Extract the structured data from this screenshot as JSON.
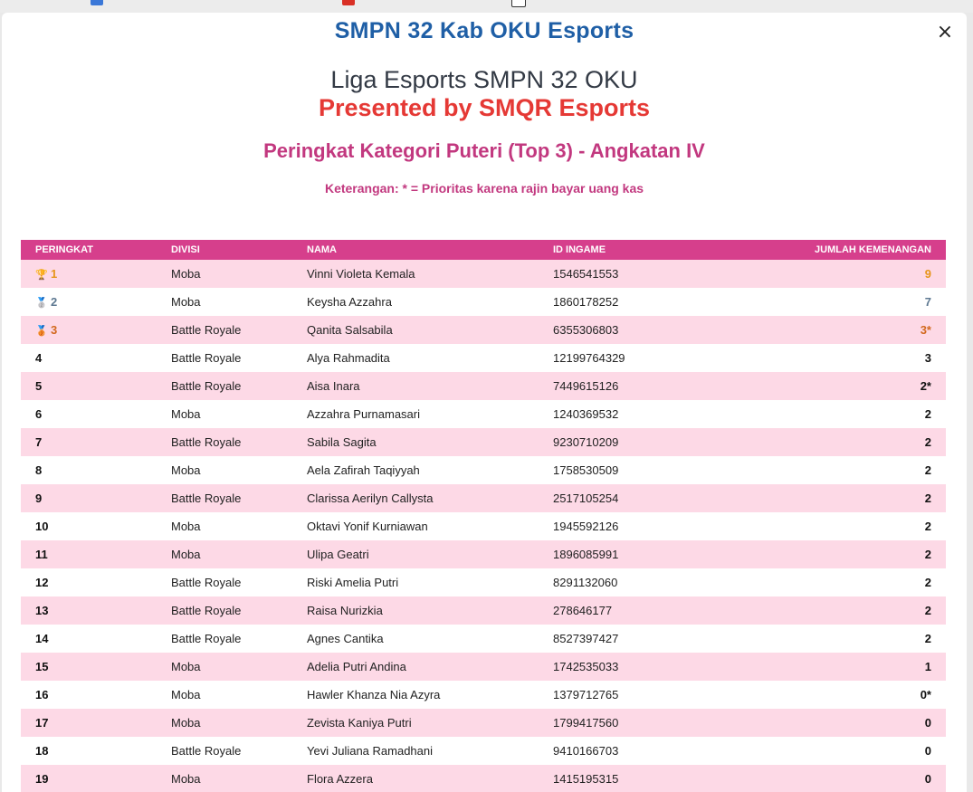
{
  "modal": {
    "close_glyph": "×"
  },
  "header": {
    "site_title": "SMPN 32 Kab OKU Esports",
    "league_title": "Liga Esports SMPN 32 OKU",
    "presented_by": "Presented by SMQR Esports",
    "category_title": "Peringkat Kategori Puteri (Top 3) - Angkatan IV",
    "note": "Keterangan: * = Prioritas karena rajin bayar uang kas"
  },
  "table": {
    "columns": [
      "PERINGKAT",
      "DIVISI",
      "NAMA",
      "ID INGAME",
      "JUMLAH KEMENANGAN"
    ],
    "rows": [
      {
        "rank": "1",
        "division": "Moba",
        "name": "Vinni Violeta Kemala",
        "id": "1546541553",
        "wins": "9",
        "medal": "🏆",
        "color": "#e6951a"
      },
      {
        "rank": "2",
        "division": "Moba",
        "name": "Keysha Azzahra",
        "id": "1860178252",
        "wins": "7",
        "medal": "🥈",
        "color": "#5d7891"
      },
      {
        "rank": "3",
        "division": "Battle Royale",
        "name": "Qanita Salsabila",
        "id": "6355306803",
        "wins": "3*",
        "medal": "🥉",
        "color": "#d2691e"
      },
      {
        "rank": "4",
        "division": "Battle Royale",
        "name": "Alya Rahmadita",
        "id": "12199764329",
        "wins": "3",
        "medal": "",
        "color": "#111111"
      },
      {
        "rank": "5",
        "division": "Battle Royale",
        "name": "Aisa Inara",
        "id": "7449615126",
        "wins": "2*",
        "medal": "",
        "color": "#111111"
      },
      {
        "rank": "6",
        "division": "Moba",
        "name": "Azzahra Purnamasari",
        "id": "1240369532",
        "wins": "2",
        "medal": "",
        "color": "#111111"
      },
      {
        "rank": "7",
        "division": "Battle Royale",
        "name": "Sabila Sagita",
        "id": "9230710209",
        "wins": "2",
        "medal": "",
        "color": "#111111"
      },
      {
        "rank": "8",
        "division": "Moba",
        "name": "Aela Zafirah Taqiyyah",
        "id": "1758530509",
        "wins": "2",
        "medal": "",
        "color": "#111111"
      },
      {
        "rank": "9",
        "division": "Battle Royale",
        "name": "Clarissa Aerilyn Callysta",
        "id": "2517105254",
        "wins": "2",
        "medal": "",
        "color": "#111111"
      },
      {
        "rank": "10",
        "division": "Moba",
        "name": "Oktavi Yonif Kurniawan",
        "id": "1945592126",
        "wins": "2",
        "medal": "",
        "color": "#111111"
      },
      {
        "rank": "11",
        "division": "Moba",
        "name": "Ulipa Geatri",
        "id": "1896085991",
        "wins": "2",
        "medal": "",
        "color": "#111111"
      },
      {
        "rank": "12",
        "division": "Battle Royale",
        "name": "Riski Amelia Putri",
        "id": "8291132060",
        "wins": "2",
        "medal": "",
        "color": "#111111"
      },
      {
        "rank": "13",
        "division": "Battle Royale",
        "name": "Raisa Nurizkia",
        "id": "278646177",
        "wins": "2",
        "medal": "",
        "color": "#111111"
      },
      {
        "rank": "14",
        "division": "Battle Royale",
        "name": "Agnes Cantika",
        "id": "8527397427",
        "wins": "2",
        "medal": "",
        "color": "#111111"
      },
      {
        "rank": "15",
        "division": "Moba",
        "name": "Adelia Putri Andina",
        "id": "1742535033",
        "wins": "1",
        "medal": "",
        "color": "#111111"
      },
      {
        "rank": "16",
        "division": "Moba",
        "name": "Hawler Khanza Nia Azyra",
        "id": "1379712765",
        "wins": "0*",
        "medal": "",
        "color": "#111111"
      },
      {
        "rank": "17",
        "division": "Moba",
        "name": "Zevista Kaniya Putri",
        "id": "1799417560",
        "wins": "0",
        "medal": "",
        "color": "#111111"
      },
      {
        "rank": "18",
        "division": "Battle Royale",
        "name": "Yevi Juliana Ramadhani",
        "id": "9410166703",
        "wins": "0",
        "medal": "",
        "color": "#111111"
      },
      {
        "rank": "19",
        "division": "Moba",
        "name": "Flora Azzera",
        "id": "1415195315",
        "wins": "0",
        "medal": "",
        "color": "#111111"
      }
    ]
  },
  "colors": {
    "site_title": "#1f5fa6",
    "presented": "#e53935",
    "accent_pink": "#c2387f",
    "header_bg": "#d63f8c",
    "row_stripe": "#fdd9e6"
  }
}
